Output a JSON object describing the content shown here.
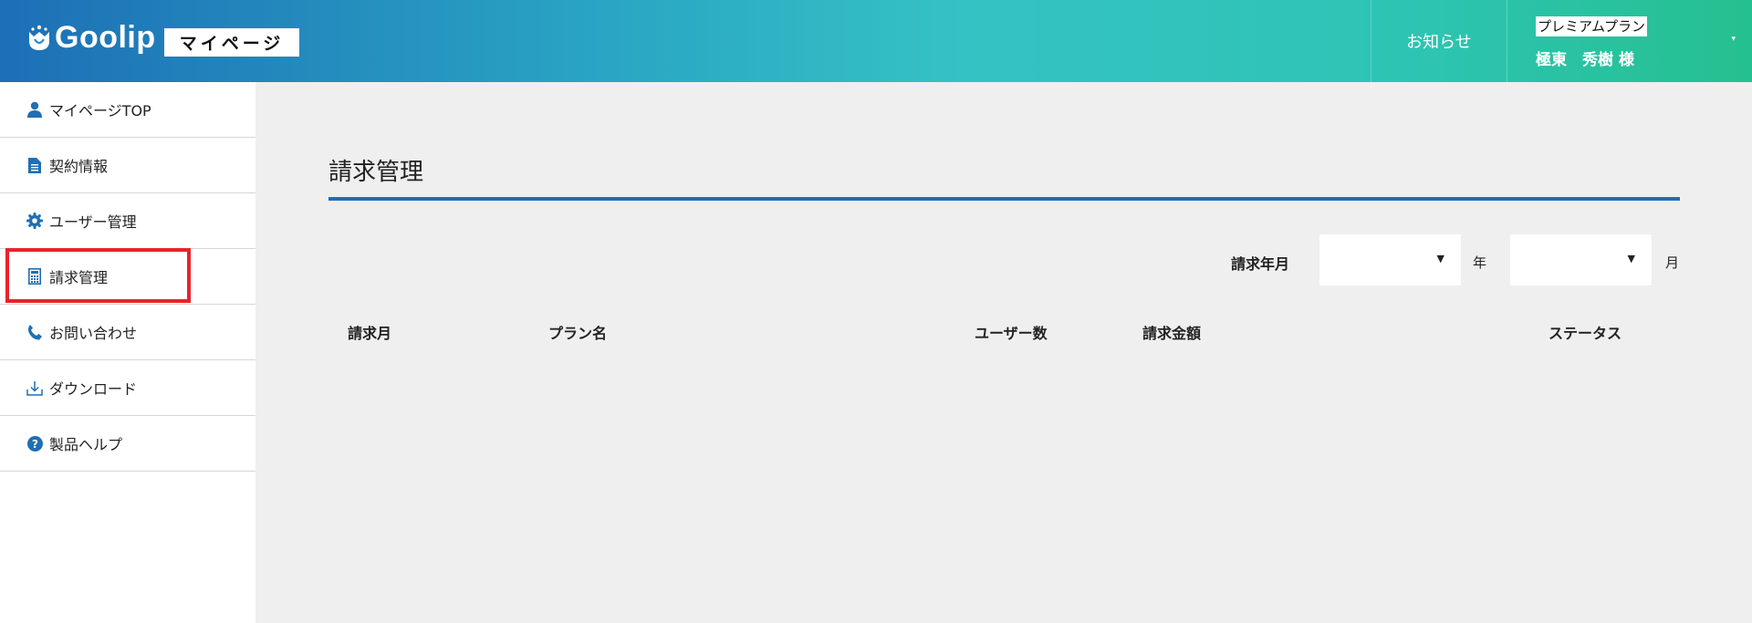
{
  "header": {
    "logo_text": "Goolip",
    "mypage_label": "マイページ",
    "notice_label": "お知らせ",
    "plan_label": "プレミアムプラン",
    "user_name": "極東　秀樹 様",
    "caret": "▾"
  },
  "sidebar": {
    "items": [
      {
        "label": "マイページTOP",
        "icon": "user-icon"
      },
      {
        "label": "契約情報",
        "icon": "document-icon"
      },
      {
        "label": "ユーザー管理",
        "icon": "gear-icon"
      },
      {
        "label": "請求管理",
        "icon": "calculator-icon"
      },
      {
        "label": "お問い合わせ",
        "icon": "phone-icon"
      },
      {
        "label": "ダウンロード",
        "icon": "download-icon"
      },
      {
        "label": "製品ヘルプ",
        "icon": "help-icon"
      }
    ],
    "highlighted_item": "請求管理"
  },
  "main": {
    "title": "請求管理",
    "filter": {
      "label": "請求年月",
      "year_value": "",
      "year_unit": "年",
      "month_value": "",
      "month_unit": "月",
      "arrow": "▼"
    },
    "table": {
      "columns": [
        "請求月",
        "プラン名",
        "ユーザー数",
        "請求金額",
        "ステータス"
      ],
      "rows": []
    }
  },
  "colors": {
    "accent": "#1f6fb3",
    "highlight": "#e8232b",
    "header_gradient_start": "#1d6fb6",
    "header_gradient_end": "#25c08f"
  }
}
